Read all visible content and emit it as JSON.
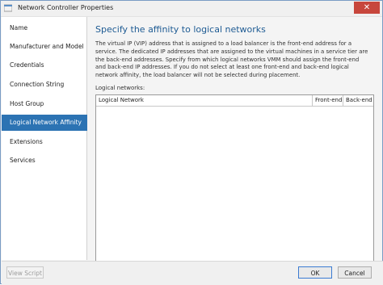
{
  "window": {
    "title": "Network Controller Properties",
    "close_label": "✕"
  },
  "sidebar": {
    "items": [
      {
        "label": "Name"
      },
      {
        "label": "Manufacturer and Model"
      },
      {
        "label": "Credentials"
      },
      {
        "label": "Connection String"
      },
      {
        "label": "Host Group"
      },
      {
        "label": "Logical Network Affinity",
        "active": true
      },
      {
        "label": "Extensions"
      },
      {
        "label": "Services"
      }
    ]
  },
  "main": {
    "heading": "Specify the affinity to logical networks",
    "description": "The virtual IP (VIP) address that is assigned to a load balancer is the front-end address for a service. The dedicated IP addresses that are assigned to the virtual machines in a service tier are the back-end addresses. Specify from which logical networks VMM should assign the front-end and back-end IP addresses. If you do not select at least one front-end and back-end logical network affinity, the load balancer will not be selected during placement.",
    "list_label": "Logical networks:",
    "columns": [
      "Logical Network",
      "Front-end",
      "Back-end"
    ],
    "rows": []
  },
  "footer": {
    "view_script": "View Script",
    "ok": "OK",
    "cancel": "Cancel"
  },
  "colors": {
    "accent": "#2c73b3",
    "heading": "#1e5b93",
    "close": "#c7463c"
  }
}
